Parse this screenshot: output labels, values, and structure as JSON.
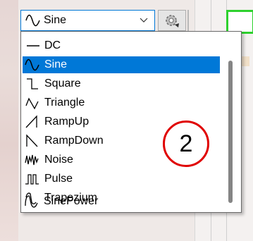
{
  "waveform": {
    "selected": "Sine",
    "options": [
      {
        "label": "DC",
        "icon": "dc-icon"
      },
      {
        "label": "Sine",
        "icon": "sine-wave-icon"
      },
      {
        "label": "Square",
        "icon": "square-wave-icon"
      },
      {
        "label": "Triangle",
        "icon": "triangle-wave-icon"
      },
      {
        "label": "RampUp",
        "icon": "ramp-up-icon"
      },
      {
        "label": "RampDown",
        "icon": "ramp-down-icon"
      },
      {
        "label": "Noise",
        "icon": "noise-icon"
      },
      {
        "label": "Pulse",
        "icon": "pulse-icon"
      },
      {
        "label": "Trapezium",
        "icon": "trapezium-icon"
      },
      {
        "label": "SinePower",
        "icon": "sine-power-icon"
      }
    ],
    "highlighted_index": 1
  },
  "annotation": {
    "label": "2",
    "color": "#e00000"
  },
  "colors": {
    "selection": "#0078d7",
    "accent_green": "#2ed12e"
  }
}
